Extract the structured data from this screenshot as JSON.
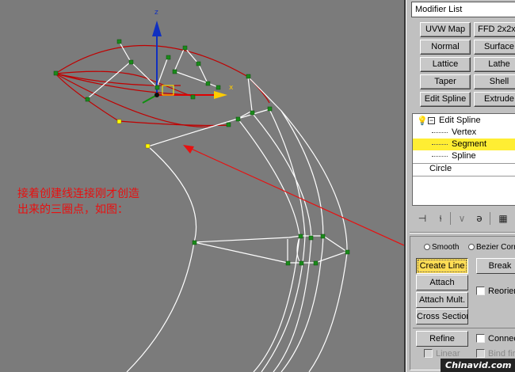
{
  "viewport": {
    "axis_z_label": "z",
    "axis_x_label": "x",
    "annotation_line1": "接着创建线连接刚才创造",
    "annotation_line2": "出来的三圈点，如图："
  },
  "command_panel": {
    "modifier_list_label": "Modifier List",
    "modifier_buttons": [
      "UVW Map",
      "FFD 2x2x2",
      "Normal",
      "Surface",
      "Lattice",
      "Lathe",
      "Taper",
      "Shell",
      "Edit Spline",
      "Extrude"
    ],
    "stack": {
      "modifier": "Edit Spline",
      "sub_objects": [
        "Vertex",
        "Segment",
        "Spline"
      ],
      "selected": "Segment",
      "base_object": "Circle"
    },
    "toolbar_icons": [
      "pin-stack-icon",
      "show-end-result-icon",
      "make-unique-icon",
      "remove-modifier-icon",
      "configure-modifier-sets-icon"
    ],
    "geometry": {
      "radio_smooth": "Smooth",
      "radio_bezier": "Bezier Corner",
      "create_line": "Create Line",
      "break": "Break",
      "attach": "Attach",
      "reorient": "Reorient",
      "attach_mult": "Attach Mult.",
      "cross_section": "Cross Section",
      "refine": "Refine",
      "connect": "Connect",
      "linear": "Linear",
      "bind_first": "Bind first"
    }
  },
  "watermark": "Chinavid.com",
  "colors": {
    "viewport_bg": "#7b7b7b",
    "panel_bg": "#c0c0c0",
    "spline_red": "#c00000",
    "spline_white": "#ffffff",
    "vertex_green": "#1a8a1a",
    "vertex_selected": "#ffff00",
    "annotation_red": "#e81010",
    "selection_yellow": "#ffee33"
  }
}
